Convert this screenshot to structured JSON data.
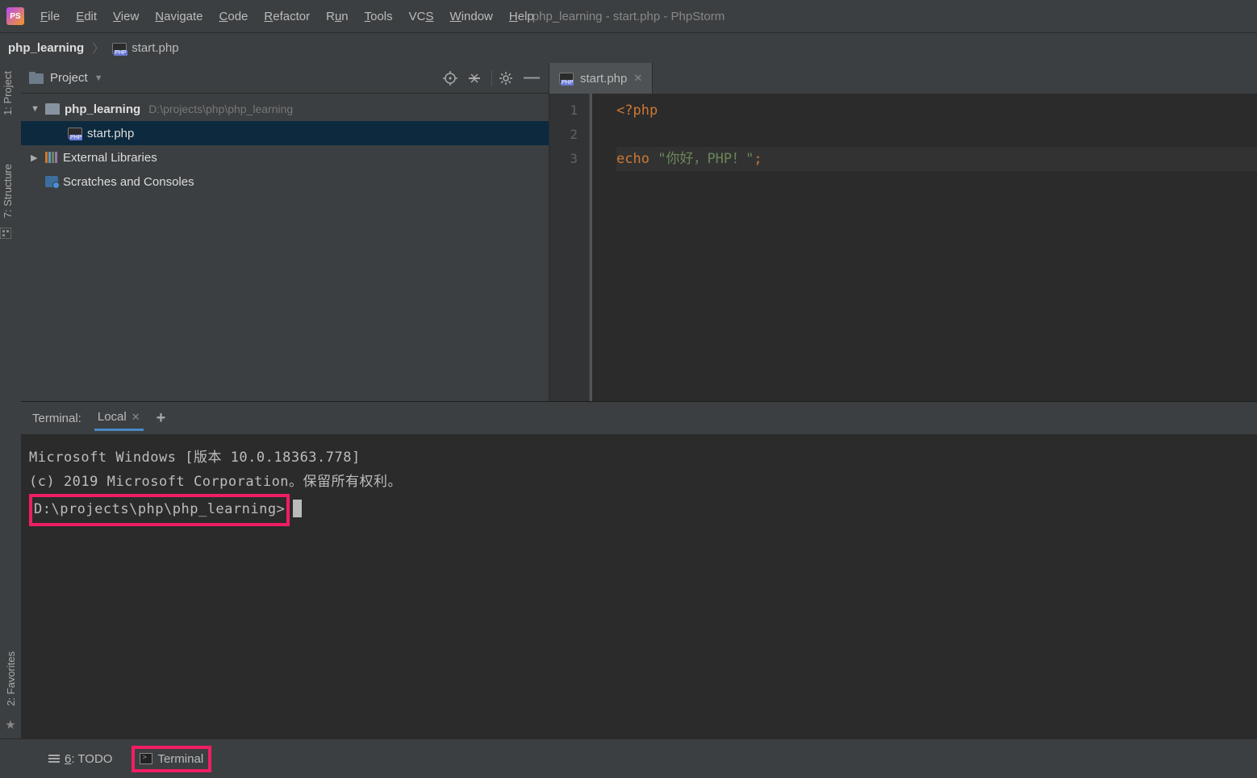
{
  "window": {
    "title": "php_learning - start.php - PhpStorm"
  },
  "menu": {
    "file": "File",
    "edit": "Edit",
    "view": "View",
    "navigate": "Navigate",
    "code": "Code",
    "refactor": "Refactor",
    "run": "Run",
    "tools": "Tools",
    "vcs": "VCS",
    "window": "Window",
    "help": "Help"
  },
  "breadcrumb": {
    "root": "php_learning",
    "file": "start.php"
  },
  "left_gutter": {
    "project": "1: Project",
    "structure": "7: Structure",
    "favorites": "2: Favorites"
  },
  "project_panel": {
    "title": "Project",
    "root": "php_learning",
    "root_path": "D:\\projects\\php\\php_learning",
    "file": "start.php",
    "external": "External Libraries",
    "scratches": "Scratches and Consoles"
  },
  "editor": {
    "tab": "start.php",
    "lines": [
      "1",
      "2",
      "3"
    ],
    "code": {
      "l1_tag": "<?php",
      "l3_kw": "echo",
      "l3_str": "\"你好，PHP！\"",
      "l3_semi": ";"
    }
  },
  "terminal": {
    "header": "Terminal:",
    "tab": "Local",
    "line1": "Microsoft Windows [版本 10.0.18363.778]",
    "line2": "(c) 2019 Microsoft Corporation。保留所有权利。",
    "prompt": "D:\\projects\\php\\php_learning>"
  },
  "statusbar": {
    "todo": "6: TODO",
    "terminal": "Terminal"
  }
}
